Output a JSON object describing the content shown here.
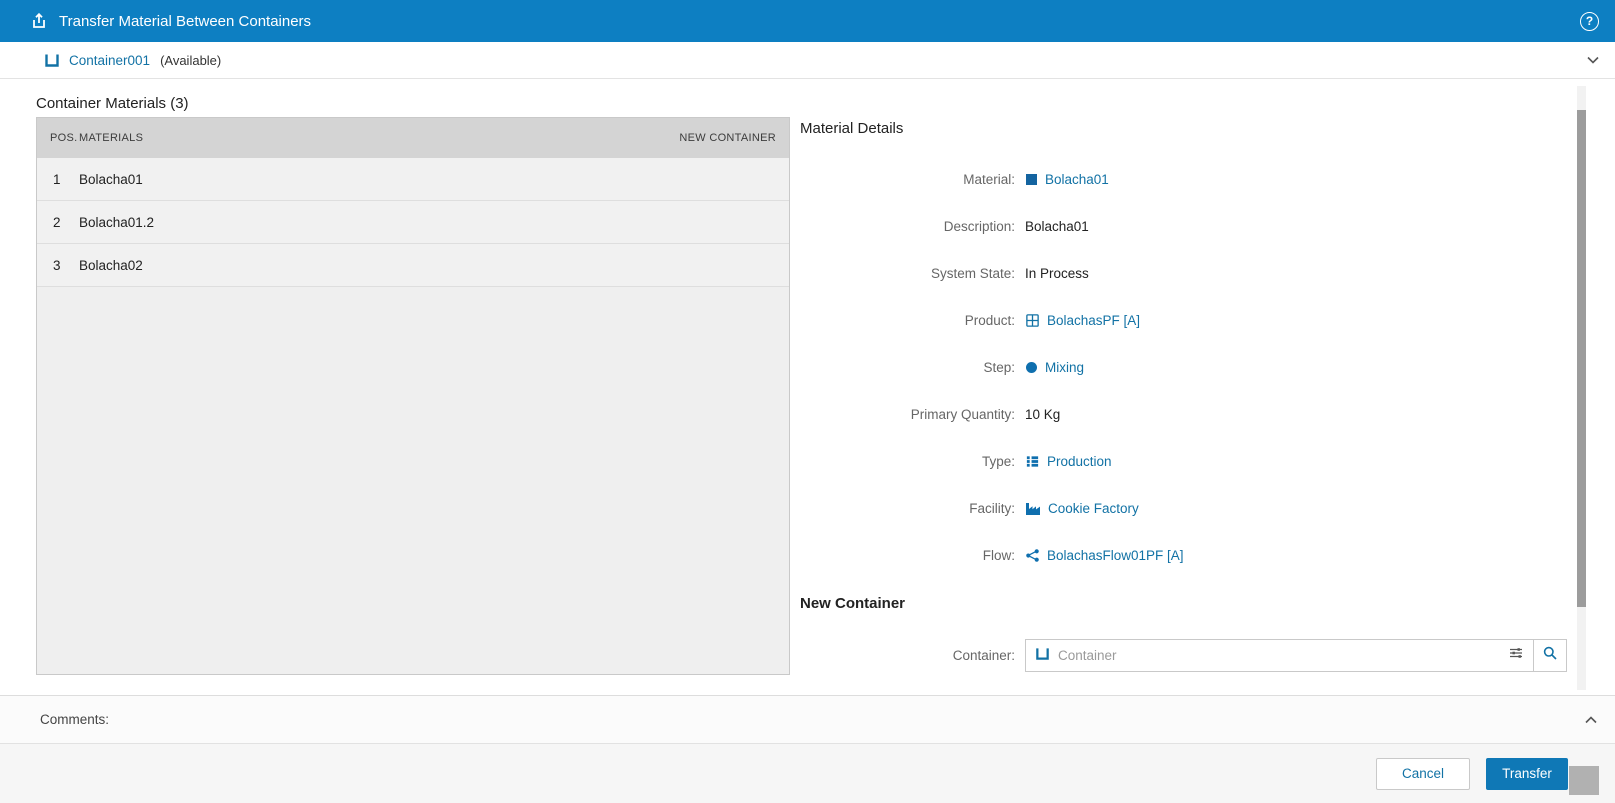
{
  "header": {
    "title": "Transfer Material Between Containers",
    "help_glyph": "?"
  },
  "container_bar": {
    "name": "Container001",
    "status": "(Available)"
  },
  "materials": {
    "title": "Container Materials (3)",
    "headers": {
      "pos": "POS.",
      "materials": "MATERIALS",
      "new_container": "NEW CONTAINER"
    },
    "rows": [
      {
        "pos": "1",
        "material": "Bolacha01"
      },
      {
        "pos": "2",
        "material": "Bolacha01.2"
      },
      {
        "pos": "3",
        "material": "Bolacha02"
      }
    ]
  },
  "details": {
    "title": "Material Details",
    "fields": [
      {
        "label": "Material:",
        "value": "Bolacha01"
      },
      {
        "label": "Description:",
        "value": "Bolacha01"
      },
      {
        "label": "System State:",
        "value": "In Process"
      },
      {
        "label": "Product:",
        "value": "BolachasPF [A]"
      },
      {
        "label": "Step:",
        "value": "Mixing"
      },
      {
        "label": "Primary Quantity:",
        "value": "10 Kg"
      },
      {
        "label": "Type:",
        "value": "Production"
      },
      {
        "label": "Facility:",
        "value": "Cookie Factory"
      },
      {
        "label": "Flow:",
        "value": "BolachasFlow01PF [A]"
      }
    ],
    "new_container": {
      "title": "New Container",
      "label": "Container:",
      "placeholder": "Container",
      "value": ""
    }
  },
  "comments": {
    "label": "Comments:"
  },
  "footer": {
    "cancel_label": "Cancel",
    "transfer_label": "Transfer"
  },
  "colors": {
    "header_blue": "#0d7fc2",
    "link_blue": "#1272a5",
    "button_blue": "#0f78b6",
    "table_header_bg": "#d4d4d4",
    "table_row_bg": "#f1f1f1"
  },
  "icons": [
    "transfer-container-icon",
    "help-circle-icon",
    "container-icon",
    "chevron-down-icon",
    "material-square-icon",
    "product-grid-icon",
    "step-circle-icon",
    "type-list-icon",
    "factory-icon",
    "flow-icon",
    "filter-sliders-icon",
    "magnifier-icon",
    "chevron-up-icon"
  ]
}
